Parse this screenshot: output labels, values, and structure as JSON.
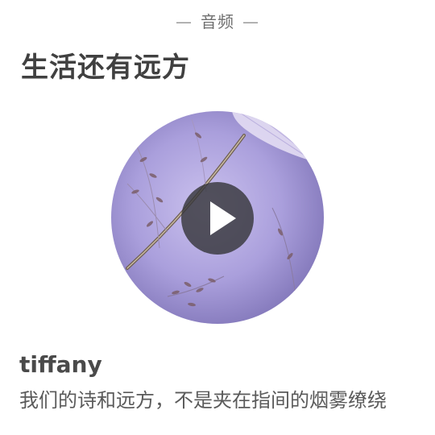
{
  "section": {
    "label": "音频",
    "dash_left": "—",
    "dash_right": "—"
  },
  "title": "生活还有远方",
  "cover": {
    "icon": "play-icon"
  },
  "author": "tiffany",
  "description": "我们的诗和远方，不是夹在指间的烟雾缭绕",
  "colors": {
    "cover_tint": "#aa9fdc",
    "play_bg": "#37373c"
  }
}
